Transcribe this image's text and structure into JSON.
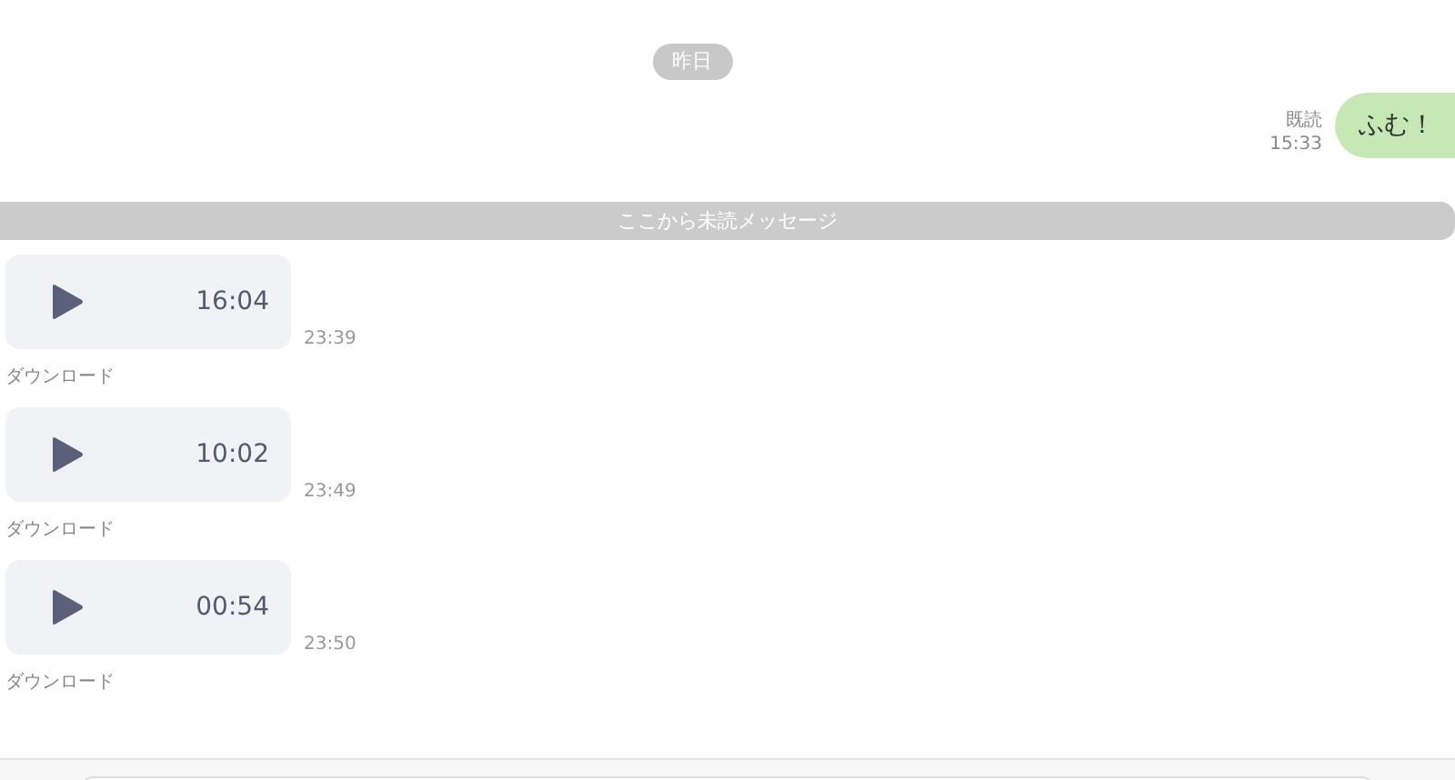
{
  "date_divider": "昨日",
  "outgoing": {
    "read_label": "既読",
    "time": "15:33",
    "text": "ふむ！"
  },
  "unread_divider": "ここから未読メッセージ",
  "voice_messages": [
    {
      "duration": "16:04",
      "time": "23:39",
      "download": "ダウンロード"
    },
    {
      "duration": "10:02",
      "time": "23:49",
      "download": "ダウンロード"
    },
    {
      "duration": "00:54",
      "time": "23:50",
      "download": "ダウンロード"
    }
  ],
  "composer": {
    "kind": "input"
  }
}
